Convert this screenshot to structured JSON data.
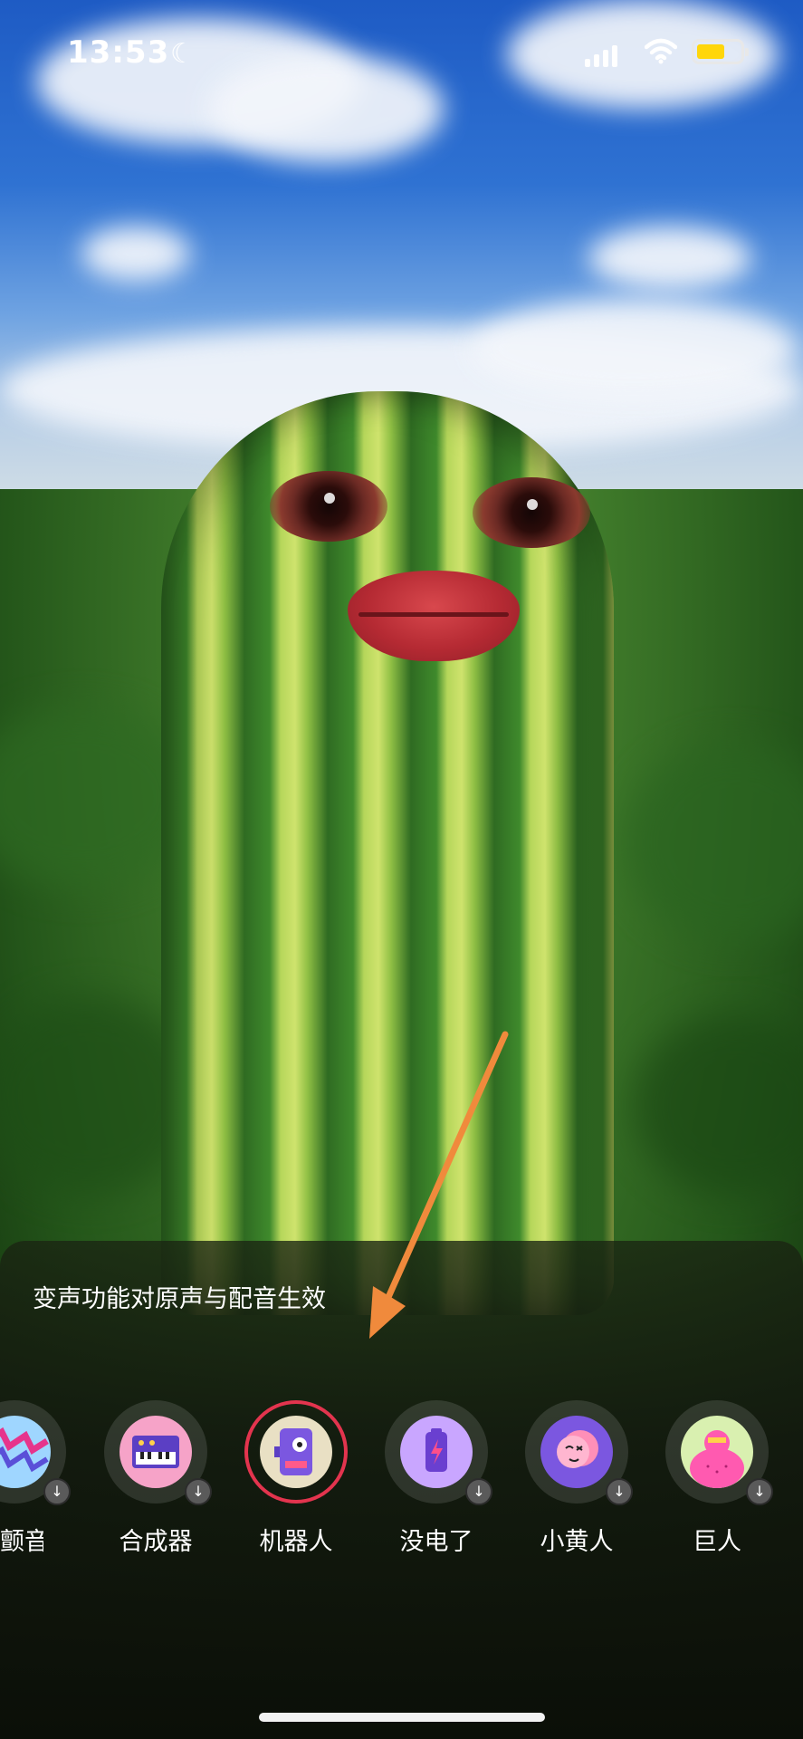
{
  "status_bar": {
    "time": "13:53",
    "moon_icon": "moon-icon",
    "signal_icon": "cellular-signal-icon",
    "wifi_icon": "wifi-icon",
    "battery_icon": "battery-icon",
    "battery_color": "#ffd60a"
  },
  "sheet": {
    "title": "变声功能对原声与配音生效",
    "effects": [
      {
        "label": "颤音",
        "icon": "zigzag-vibrato-icon",
        "selected": false,
        "download": true
      },
      {
        "label": "合成器",
        "icon": "synthesizer-icon",
        "selected": false,
        "download": true
      },
      {
        "label": "机器人",
        "icon": "robot-icon",
        "selected": true,
        "download": false
      },
      {
        "label": "没电了",
        "icon": "battery-can-icon",
        "selected": false,
        "download": true
      },
      {
        "label": "小黄人",
        "icon": "minion-face-icon",
        "selected": false,
        "download": true
      },
      {
        "label": "巨人",
        "icon": "giant-icon",
        "selected": false,
        "download": true
      }
    ],
    "selected_ring_color": "#e3344e",
    "download_icon": "download-arrow-icon"
  },
  "annotation": {
    "arrow_color": "#f08a3c"
  }
}
